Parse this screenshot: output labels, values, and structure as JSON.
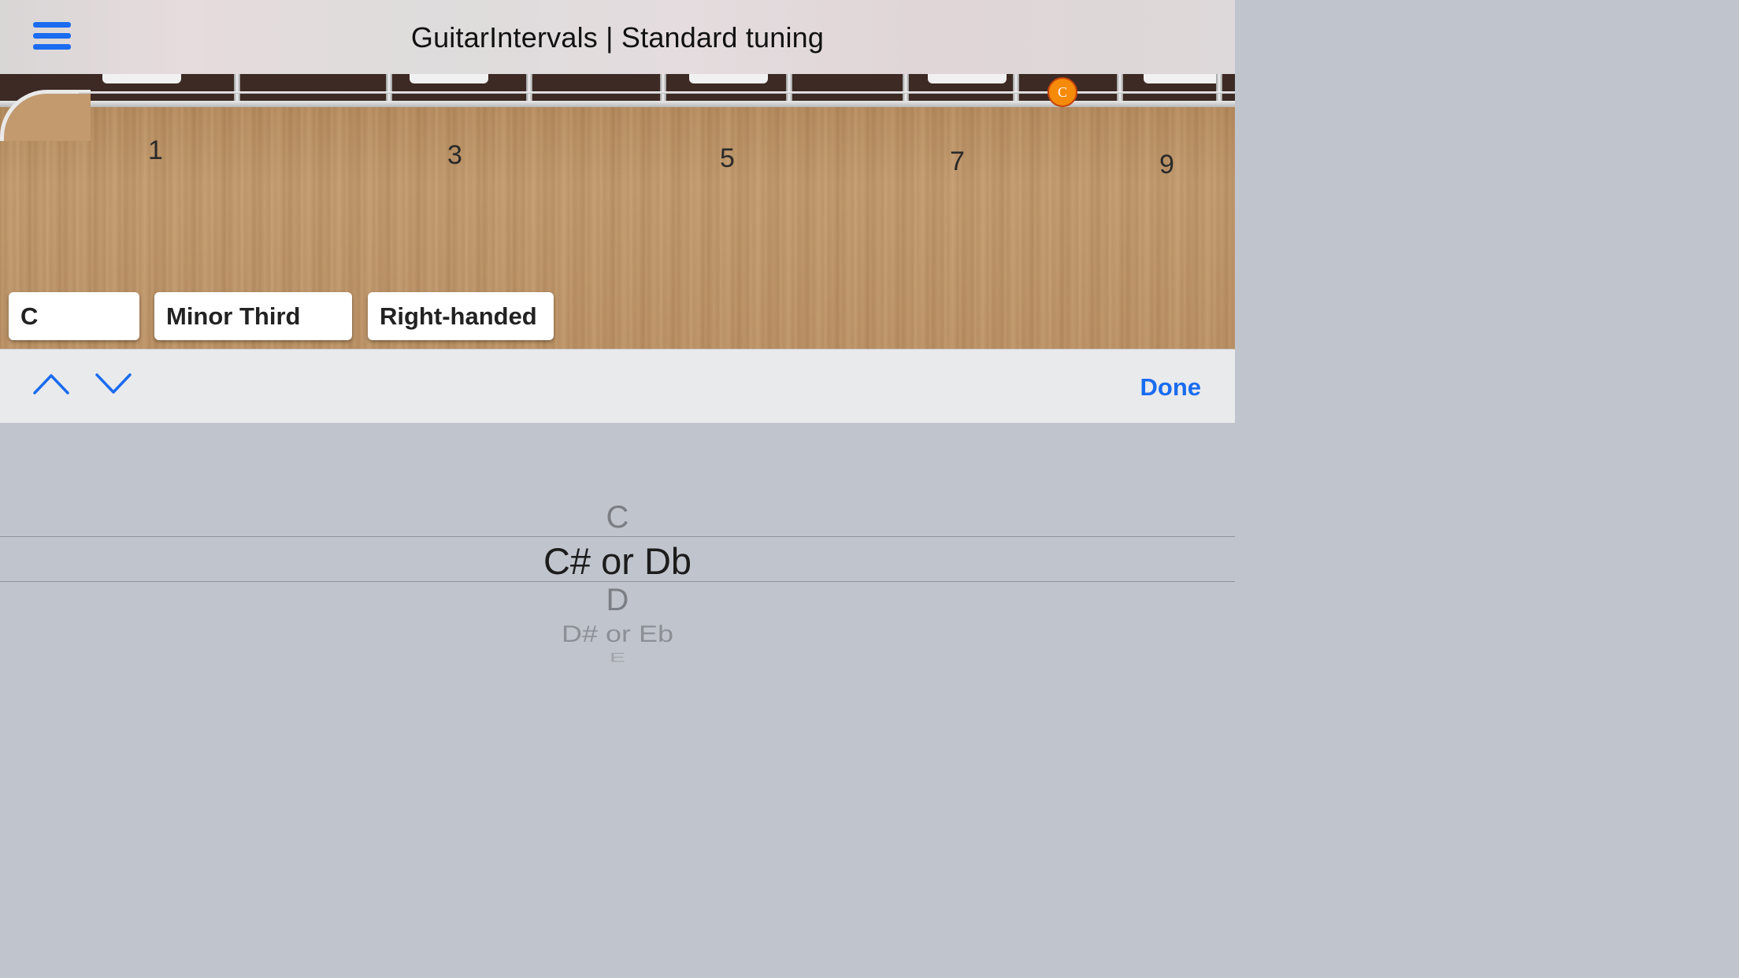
{
  "header": {
    "title": "GuitarIntervals | Standard tuning",
    "menu_icon": "hamburger-menu-icon"
  },
  "fretboard": {
    "fret_numbers": [
      "1",
      "3",
      "5",
      "7",
      "9"
    ],
    "highlighted_note": "C",
    "highlight_color": "#f58a0b"
  },
  "selectors": {
    "note": "C",
    "interval": "Minor Third",
    "handedness": "Right-handed"
  },
  "toolbar": {
    "previous_icon": "chevron-up-icon",
    "next_icon": "chevron-down-icon",
    "done_label": "Done",
    "accent_color": "#1a6cf0"
  },
  "picker": {
    "items": [
      "C",
      "C# or Db",
      "D",
      "D# or Eb",
      "E"
    ],
    "selected": "C# or Db"
  }
}
